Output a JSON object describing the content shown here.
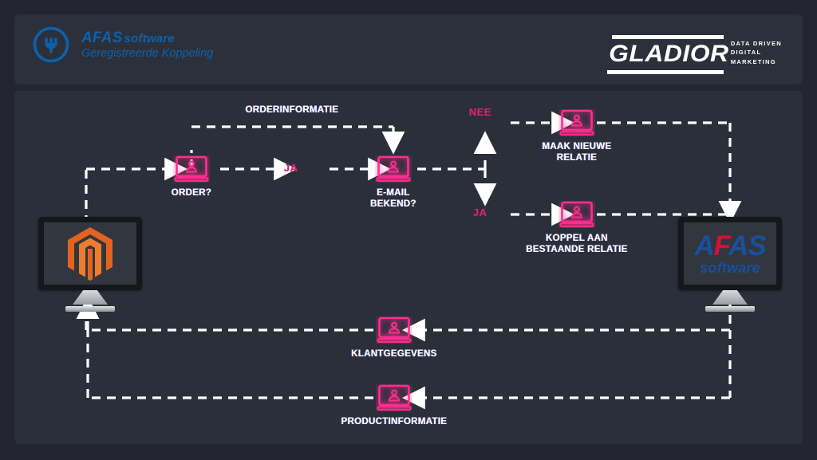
{
  "header": {
    "afas_logo": {
      "icon": "plug-circle-icon",
      "brand": "AFAS",
      "brand_suffix": "software",
      "subtitle": "Geregistreerde Koppeling",
      "color": "#0d61ab"
    },
    "gladior_logo": {
      "wordmark": "GLADIOR",
      "tagline_lines": [
        "DATA DRIVEN",
        "DIGITAL",
        "MARKETING"
      ],
      "color": "#ffffff"
    }
  },
  "diagram": {
    "accent_pink": "#ff2d8e",
    "branch_color": "#e81a63",
    "wire_color": "#ffffff",
    "systems": [
      {
        "id": "magento",
        "name": "magento-monitor",
        "logo": "magento-logo"
      },
      {
        "id": "afas",
        "name": "afas-monitor",
        "logo": "afas-logo",
        "logo_text": "AFAS",
        "logo_text_sub": "software"
      }
    ],
    "nodes": [
      {
        "id": "order",
        "label": "ORDER?",
        "icon": "user-screen-icon"
      },
      {
        "id": "email",
        "label": "E-MAIL\nBEKEND?",
        "icon": "user-screen-icon"
      },
      {
        "id": "maak",
        "label": "MAAK NIEUWE\nRELATIE",
        "icon": "user-screen-icon"
      },
      {
        "id": "koppel",
        "label": "KOPPEL AAN\nBESTAANDE RELATIE",
        "icon": "user-screen-icon"
      },
      {
        "id": "klant",
        "label": "KLANTGEGEVENS",
        "icon": "user-screen-icon"
      },
      {
        "id": "product",
        "label": "PRODUCTINFORMATIE",
        "icon": "user-screen-icon"
      }
    ],
    "flow_labels": [
      {
        "id": "orderinformatie",
        "text": "ORDERINFORMATIE"
      }
    ],
    "branch_labels": [
      {
        "id": "ja1",
        "text": "JA"
      },
      {
        "id": "nee",
        "text": "NEE"
      },
      {
        "id": "ja2",
        "text": "JA"
      }
    ]
  }
}
